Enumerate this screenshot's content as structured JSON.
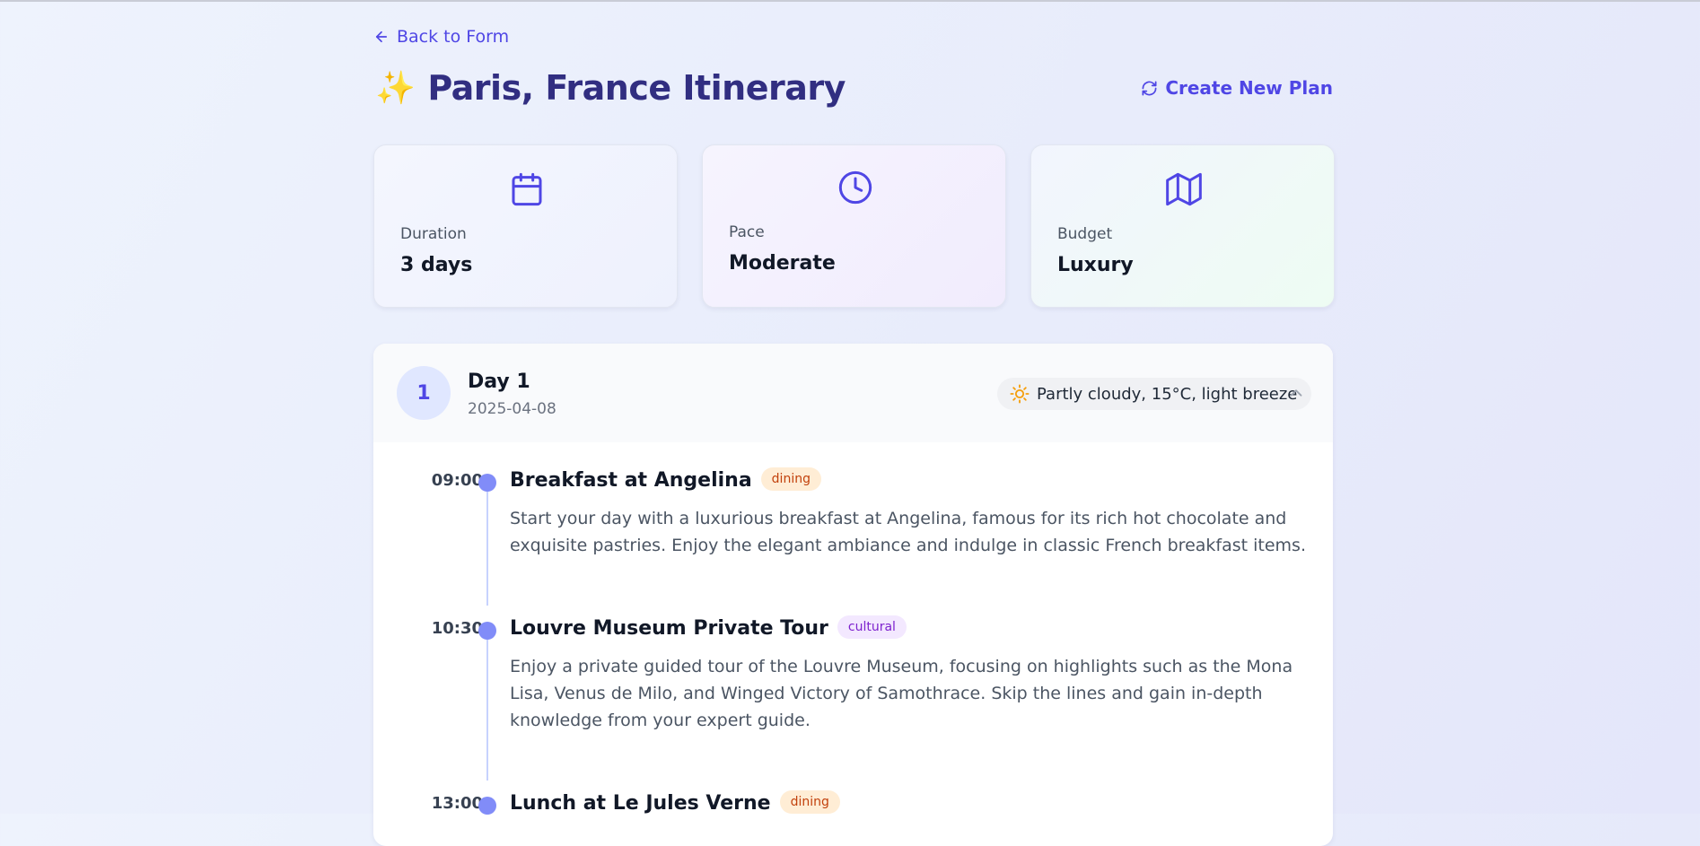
{
  "nav": {
    "back_label": "Back to Form",
    "new_plan_label": "Create New Plan"
  },
  "header": {
    "emoji": "✨",
    "title": "Paris, France Itinerary"
  },
  "summary": [
    {
      "icon": "calendar-icon",
      "label": "Duration",
      "value": "3 days"
    },
    {
      "icon": "clock-icon",
      "label": "Pace",
      "value": "Moderate"
    },
    {
      "icon": "map-icon",
      "label": "Budget",
      "value": "Luxury"
    }
  ],
  "day": {
    "number": "1",
    "title": "Day 1",
    "date": "2025-04-08",
    "weather": "Partly cloudy, 15°C, light breeze",
    "weather_icon": "sun-icon",
    "collapse_icon": "chevron-up-icon",
    "activities": [
      {
        "time": "09:00",
        "title": "Breakfast at Angelina",
        "tag": "dining",
        "description": "Start your day with a luxurious breakfast at Angelina, famous for its rich hot chocolate and exquisite pastries. Enjoy the elegant ambiance and indulge in classic French breakfast items."
      },
      {
        "time": "10:30",
        "title": "Louvre Museum Private Tour",
        "tag": "cultural",
        "description": "Enjoy a private guided tour of the Louvre Museum, focusing on highlights such as the Mona Lisa, Venus de Milo, and Winged Victory of Samothrace. Skip the lines and gain in-depth knowledge from your expert guide."
      },
      {
        "time": "13:00",
        "title": "Lunch at Le Jules Verne",
        "tag": "dining",
        "description": ""
      }
    ]
  },
  "colors": {
    "accent": "#4f46e5",
    "title": "#312e81",
    "timeline_dot": "#818cf8",
    "dining_badge_bg": "#ffedd5",
    "dining_badge_text": "#c2410c",
    "cultural_badge_bg": "#f3e8ff",
    "cultural_badge_text": "#7e22ce"
  }
}
